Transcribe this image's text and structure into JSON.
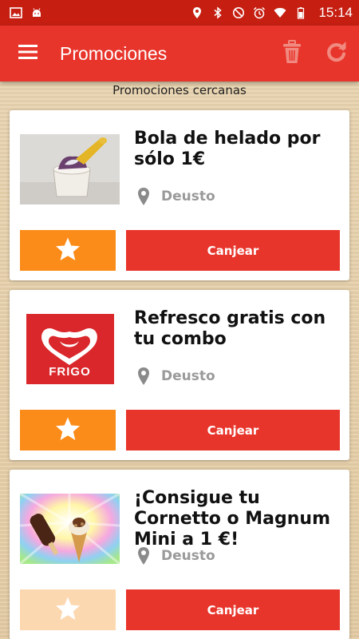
{
  "status_bar": {
    "time": "15:14",
    "icons": [
      "image-icon",
      "android-icon",
      "location-icon",
      "bluetooth-icon",
      "do-not-disturb-icon",
      "alarm-icon",
      "wifi-icon",
      "battery-icon"
    ]
  },
  "app_bar": {
    "title": "Promociones",
    "menu_icon": "hamburger-menu-icon",
    "actions": [
      "trash-icon",
      "refresh-icon"
    ]
  },
  "section_title": "Promociones cercanas",
  "promotions": [
    {
      "title": "Bola de helado por sólo 1€",
      "location": "Deusto",
      "redeem_label": "Canjear",
      "image": "ice-cream-cup"
    },
    {
      "title": "Refresco gratis con tu combo",
      "location": "Deusto",
      "redeem_label": "Canjear",
      "image": "frigo-logo",
      "logo_text": "FRIGO"
    },
    {
      "title": "¡Consigue tu Cornetto o Magnum Mini a 1  €!",
      "location": "Deusto",
      "redeem_label": "Canjear",
      "image": "cornetto-magnum"
    }
  ],
  "colors": {
    "status_bar": "#c61f12",
    "app_bar": "#e8352b",
    "favorite": "#fb8c1a",
    "redeem": "#e8352b"
  }
}
